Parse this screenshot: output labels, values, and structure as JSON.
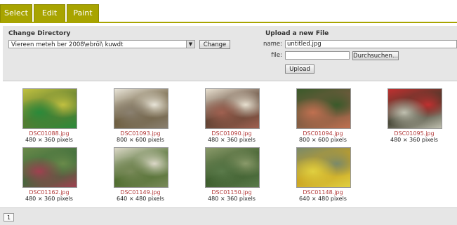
{
  "tabs": [
    {
      "label": "Select"
    },
    {
      "label": "Edit"
    },
    {
      "label": "Paint"
    }
  ],
  "change_directory": {
    "heading": "Change Directory",
    "selected_path": "Viereen meteh ber 2008\\ebröl\\ kuwdt",
    "change_button": "Change"
  },
  "upload": {
    "heading": "Upload a new File",
    "name_label": "name:",
    "name_value": "untitled.jpg",
    "file_label": "file:",
    "file_value": "",
    "browse_button": "Durchsuchen...",
    "upload_button": "Upload"
  },
  "gallery": {
    "items": [
      {
        "name": "DSC01088.jpg",
        "size": "480 × 360 pixels",
        "colors": [
          "#5a7a30",
          "#2a8a3a",
          "#c0c040"
        ]
      },
      {
        "name": "DSC01093.jpg",
        "size": "800 × 600 pixels",
        "colors": [
          "#6a5a3a",
          "#8a8070",
          "#e8e4d8"
        ]
      },
      {
        "name": "DSC01090.jpg",
        "size": "480 × 360 pixels",
        "colors": [
          "#5a4030",
          "#a06050",
          "#e8e0d0"
        ]
      },
      {
        "name": "DSC01094.jpg",
        "size": "800 × 600 pixels",
        "colors": [
          "#7a5a40",
          "#c07050",
          "#3a5a2a"
        ]
      },
      {
        "name": "DSC01095.jpg",
        "size": "480 × 360 pixels",
        "colors": [
          "#3a3a2a",
          "#c0c0b0",
          "#c03030"
        ]
      },
      {
        "name": "DSC01162.jpg",
        "size": "480 × 360 pixels",
        "colors": [
          "#3a6a3a",
          "#a04050",
          "#6a8a4a"
        ]
      },
      {
        "name": "DSC01149.jpg",
        "size": "640 × 480 pixels",
        "colors": [
          "#4a6a2a",
          "#7a8a5a",
          "#dcd8c8"
        ]
      },
      {
        "name": "DSC01150.jpg",
        "size": "480 × 360 pixels",
        "colors": [
          "#3a5a2a",
          "#5a7a4a",
          "#8a9a6a"
        ]
      },
      {
        "name": "DSC01148.jpg",
        "size": "640 × 480 pixels",
        "colors": [
          "#c8a020",
          "#e0d040",
          "#7a8a6a"
        ]
      }
    ]
  },
  "footer": {
    "pager_label": "1"
  },
  "theme": {
    "tab_color": "#a8a400",
    "filename_color": "#b23a3a",
    "panel_color": "#e6e6e6"
  }
}
